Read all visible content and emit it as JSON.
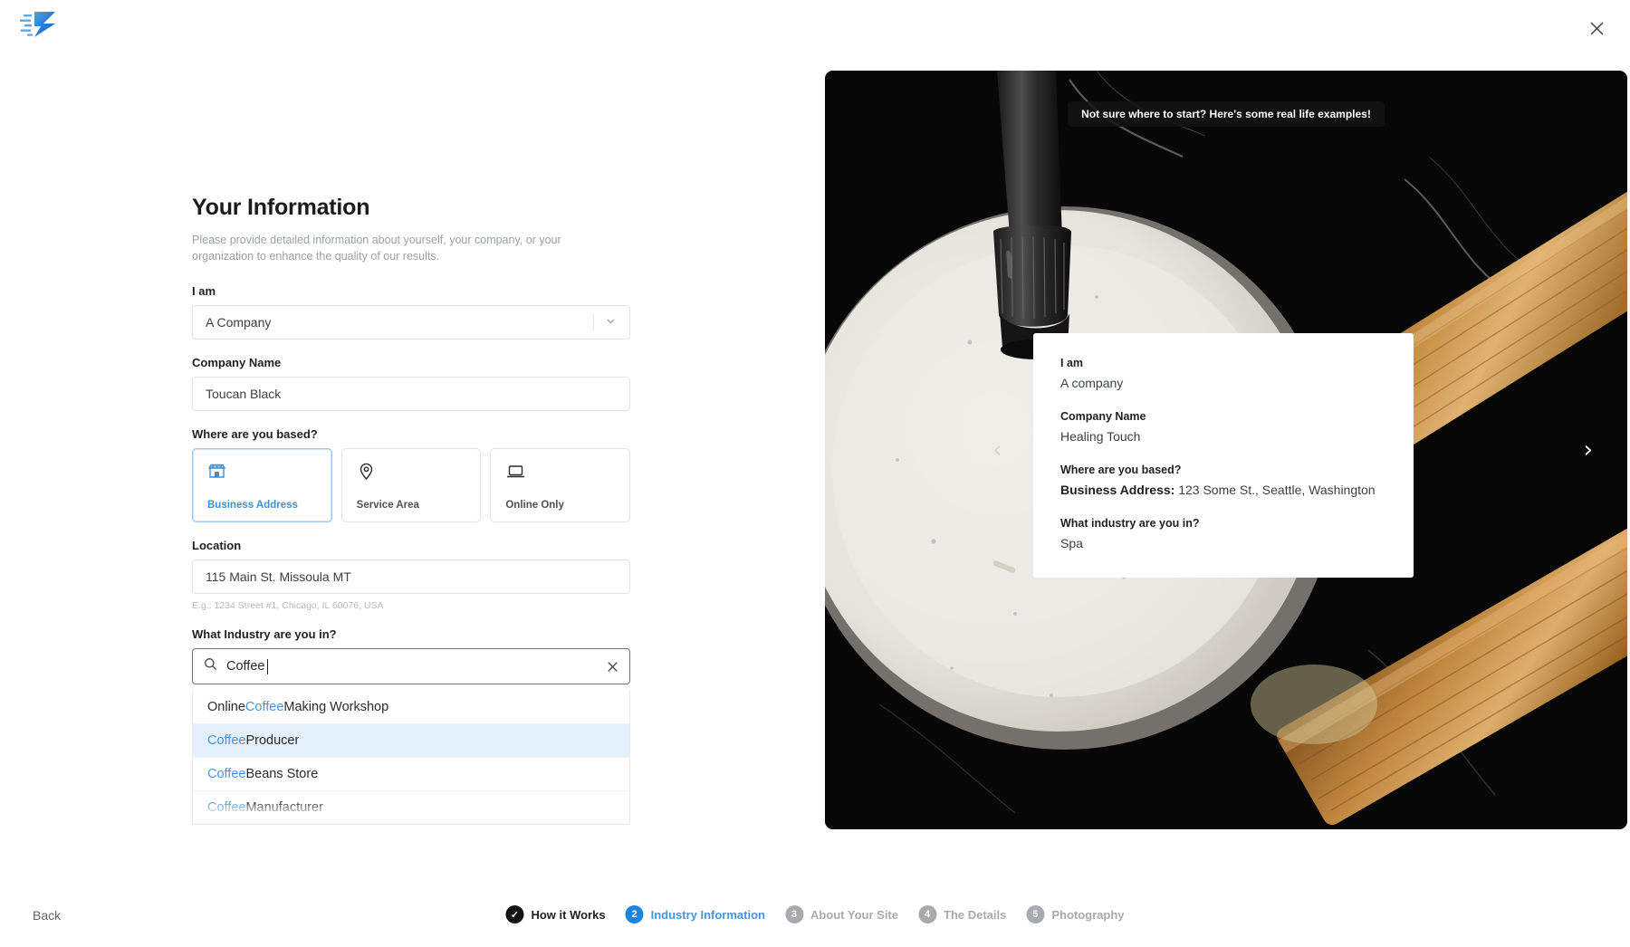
{
  "brand": {
    "logo_name": "express-logo",
    "accent": "#1a84e0"
  },
  "header": {
    "close_label": "✕"
  },
  "form": {
    "title": "Your Information",
    "subtitle": "Please provide detailed information about yourself, your company, or your organization to enhance the quality of our results.",
    "i_am": {
      "label": "I am",
      "value": "A Company"
    },
    "company_name": {
      "label": "Company Name",
      "value": "Toucan Black"
    },
    "based": {
      "label": "Where are you based?",
      "options": [
        {
          "label": "Business Address",
          "icon": "storefront-icon",
          "selected": true
        },
        {
          "label": "Service Area",
          "icon": "map-pin-icon",
          "selected": false
        },
        {
          "label": "Online Only",
          "icon": "laptop-icon",
          "selected": false
        }
      ]
    },
    "location": {
      "label": "Location",
      "value": "115 Main St. Missoula MT",
      "hint": "E.g.: 1234 Street #1, Chicago, IL 60076, USA"
    },
    "industry": {
      "label": "What Industry are you in?",
      "query": "Coffee",
      "search_icon": "search-icon",
      "clear_icon": "clear-x-icon",
      "suggestions": [
        {
          "prefix": "Online ",
          "match": "Coffee",
          "suffix": " Making Workshop",
          "highlighted": false
        },
        {
          "prefix": "",
          "match": "Coffee",
          "suffix": " Producer",
          "highlighted": true
        },
        {
          "prefix": "",
          "match": "Coffee",
          "suffix": " Beans Store",
          "highlighted": false
        },
        {
          "prefix": "",
          "match": "Coffee",
          "suffix": " Manufacturer",
          "highlighted": false
        }
      ]
    }
  },
  "preview": {
    "banner": "Not sure where to start? Here's some real life examples!",
    "prev_arrow": "‹",
    "next_arrow": "›",
    "card": {
      "i_am_label": "I am",
      "i_am_value": "A company",
      "company_label": "Company Name",
      "company_value": "Healing Touch",
      "based_label": "Where are you based?",
      "based_value_bold": "Business Address:",
      "based_value_rest": " 123 Some St., Seattle, Washington",
      "industry_label": "What industry are you in?",
      "industry_value": "Spa"
    }
  },
  "footer": {
    "back": "Back",
    "steps": [
      {
        "marker": "✓",
        "label": "How it Works",
        "state": "done"
      },
      {
        "marker": "2",
        "label": "Industry Information",
        "state": "active"
      },
      {
        "marker": "3",
        "label": "About Your Site",
        "state": "todo"
      },
      {
        "marker": "4",
        "label": "The Details",
        "state": "todo"
      },
      {
        "marker": "5",
        "label": "Photography",
        "state": "todo"
      }
    ]
  }
}
